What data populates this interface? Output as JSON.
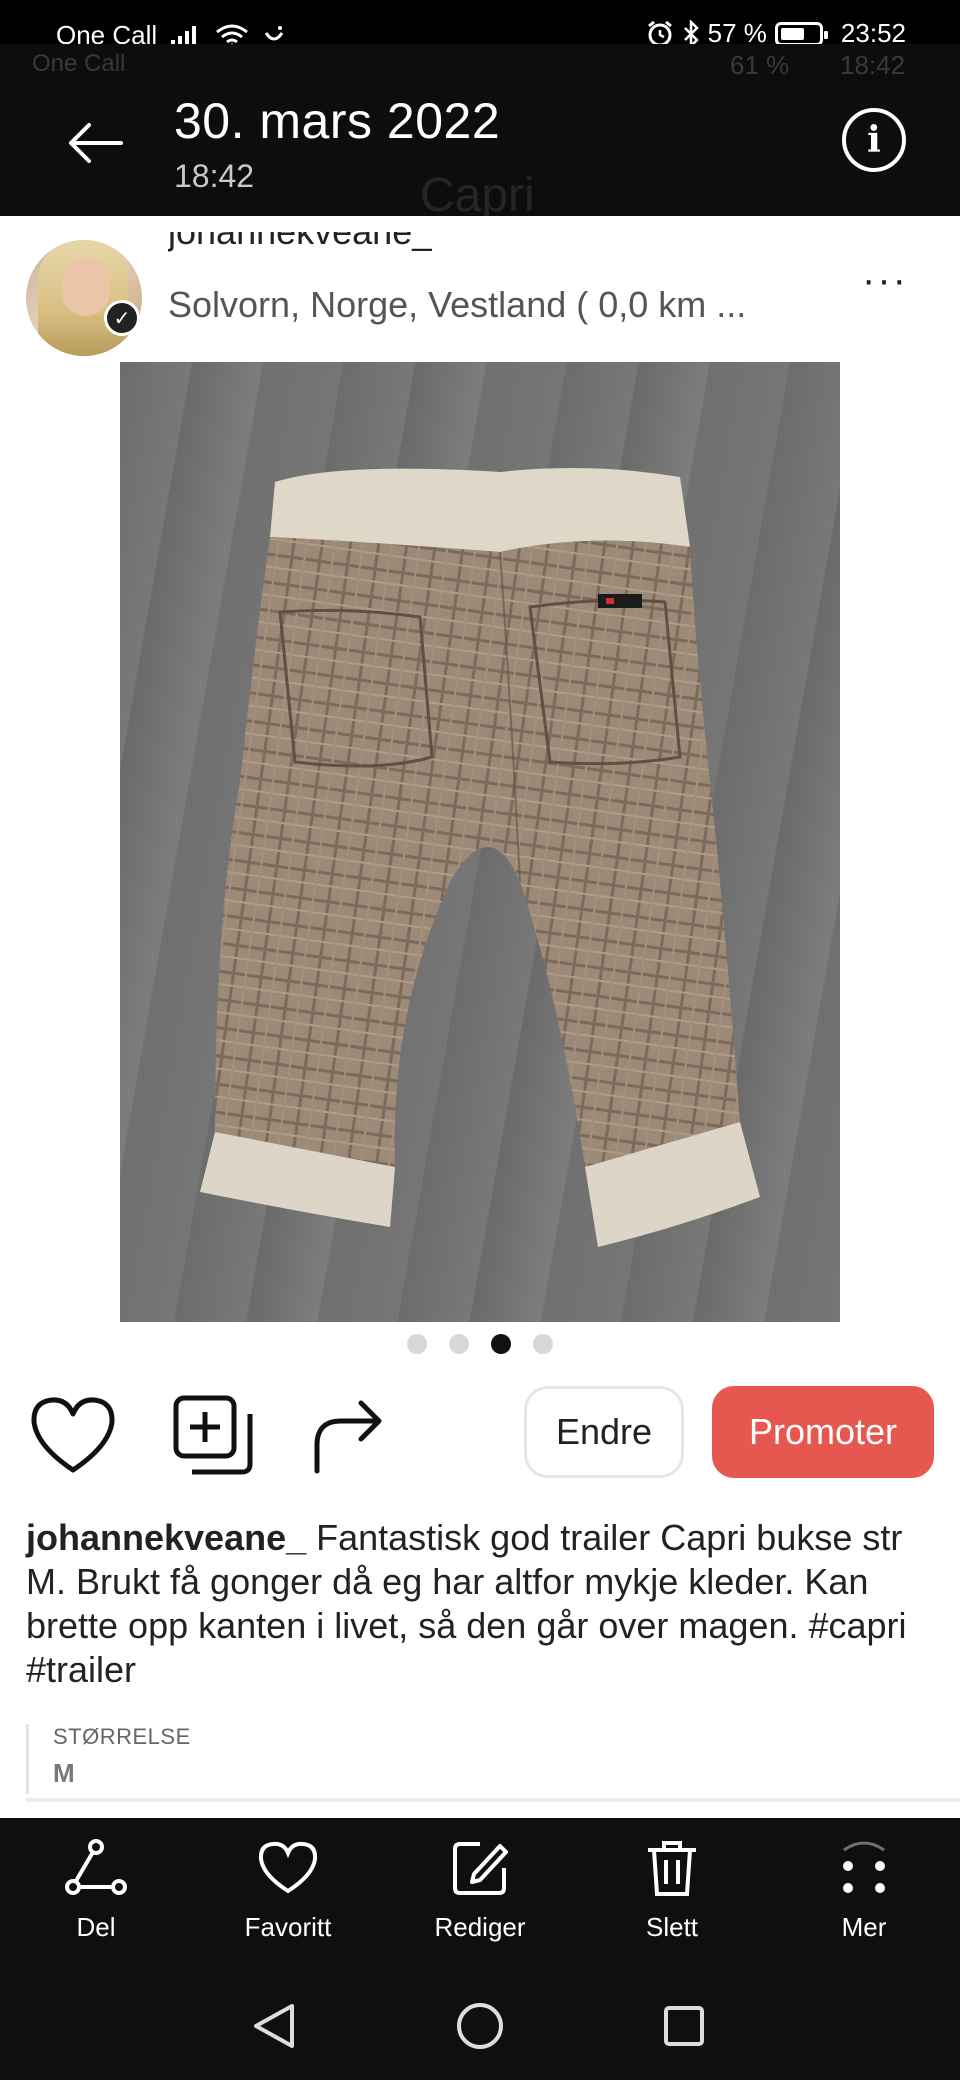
{
  "status_bar": {
    "carrier": "One Call",
    "battery": "57 %",
    "time": "23:52"
  },
  "header": {
    "date": "30. mars 2022",
    "time": "18:42",
    "ghost_carrier": "One Call",
    "ghost_battery": "61 %",
    "ghost_time": "18:42",
    "ghost_title": "Capri"
  },
  "post": {
    "username_top": "johannekveane_",
    "location": "Solvorn, Norge, Vestland ( 0,0 km ...",
    "image_count": 4,
    "active_image_index": 2,
    "username": "johannekveane_",
    "description": " Fantastisk god trailer Capri bukse str M. Brukt få gonger då eg har altfor mykje kleder. Kan brette opp kanten i livet, så den går over magen. #capri #trailer",
    "size_label": "STØRRELSE",
    "size_value": "M"
  },
  "actions": {
    "edit_label": "Endre",
    "promote_label": "Promoter"
  },
  "toolbar": {
    "items": [
      {
        "label": "Del",
        "icon": "share-icon"
      },
      {
        "label": "Favoritt",
        "icon": "heart-icon"
      },
      {
        "label": "Rediger",
        "icon": "edit-icon"
      },
      {
        "label": "Slett",
        "icon": "trash-icon"
      },
      {
        "label": "Mer",
        "icon": "more-icon"
      }
    ]
  },
  "colors": {
    "promote": "#e6584f",
    "bar": "#0f0f0f"
  }
}
